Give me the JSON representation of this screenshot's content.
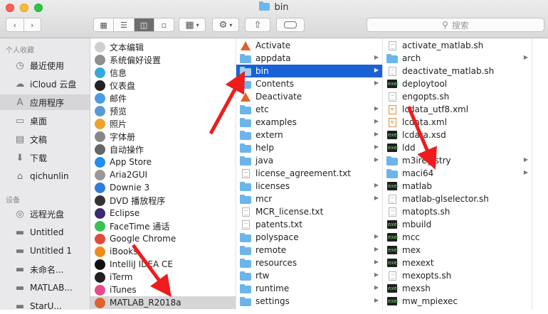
{
  "window": {
    "title": "bin"
  },
  "toolbar": {
    "search_placeholder": "搜索"
  },
  "sidebar": {
    "favorites_header": "个人收藏",
    "favorites": [
      {
        "label": "最近使用",
        "icon": "clock-icon"
      },
      {
        "label": "iCloud 云盘",
        "icon": "cloud-icon"
      },
      {
        "label": "应用程序",
        "icon": "applications-icon",
        "selected": true
      },
      {
        "label": "桌面",
        "icon": "desktop-icon"
      },
      {
        "label": "文稿",
        "icon": "documents-icon"
      },
      {
        "label": "下载",
        "icon": "download-icon"
      },
      {
        "label": "qichunlin",
        "icon": "home-icon"
      }
    ],
    "devices_header": "设备",
    "devices": [
      {
        "label": "远程光盘",
        "icon": "disc-icon"
      },
      {
        "label": "Untitled",
        "icon": "disk-icon"
      },
      {
        "label": "Untitled 1",
        "icon": "disk-icon"
      },
      {
        "label": "未命名...",
        "icon": "disk-icon"
      },
      {
        "label": "MATLAB...",
        "icon": "disk-icon"
      },
      {
        "label": "StarU...",
        "icon": "disk-icon"
      }
    ]
  },
  "columns": {
    "apps": [
      {
        "label": "文本编辑",
        "icon": "textedit-icon",
        "color": "#cfcfcf"
      },
      {
        "label": "系统偏好设置",
        "icon": "gear-icon",
        "color": "#8e8e93"
      },
      {
        "label": "信息",
        "icon": "messages-icon",
        "color": "#34aadc"
      },
      {
        "label": "仪表盘",
        "icon": "dashboard-icon",
        "color": "#222222"
      },
      {
        "label": "邮件",
        "icon": "mail-icon",
        "color": "#4a9be8"
      },
      {
        "label": "预览",
        "icon": "preview-icon",
        "color": "#5b9bd5"
      },
      {
        "label": "照片",
        "icon": "photos-icon",
        "color": "#f0a030"
      },
      {
        "label": "字体册",
        "icon": "fontbook-icon",
        "color": "#888888"
      },
      {
        "label": "自动操作",
        "icon": "automator-icon",
        "color": "#666666"
      },
      {
        "label": "App Store",
        "icon": "appstore-icon",
        "color": "#1f8ff0"
      },
      {
        "label": "Aria2GUI",
        "icon": "aria2gui-icon",
        "color": "#999999"
      },
      {
        "label": "Downie 3",
        "icon": "downie-icon",
        "color": "#2f7de0"
      },
      {
        "label": "DVD 播放程序",
        "icon": "dvd-icon",
        "color": "#333333"
      },
      {
        "label": "Eclipse",
        "icon": "eclipse-icon",
        "color": "#3b2a6e"
      },
      {
        "label": "FaceTime 通话",
        "icon": "facetime-icon",
        "color": "#37c34f"
      },
      {
        "label": "Google Chrome",
        "icon": "chrome-icon",
        "color": "#e04a3a"
      },
      {
        "label": "iBooks",
        "icon": "ibooks-icon",
        "color": "#f08c1e"
      },
      {
        "label": "IntelliJ IDEA CE",
        "icon": "intellij-icon",
        "color": "#111111"
      },
      {
        "label": "iTerm",
        "icon": "iterm-icon",
        "color": "#222222"
      },
      {
        "label": "iTunes",
        "icon": "itunes-icon",
        "color": "#e84a8e"
      },
      {
        "label": "MATLAB_R2018a",
        "icon": "matlab-icon",
        "color": "#e0622c",
        "selected": true
      }
    ],
    "matlab_contents": [
      {
        "label": "Activate",
        "type": "matlab",
        "folder_arrow": false
      },
      {
        "label": "appdata",
        "type": "folder",
        "folder_arrow": true
      },
      {
        "label": "bin",
        "type": "folder",
        "folder_arrow": true,
        "selected": true
      },
      {
        "label": "Contents",
        "type": "folder",
        "folder_arrow": true
      },
      {
        "label": "Deactivate",
        "type": "matlab",
        "folder_arrow": false
      },
      {
        "label": "etc",
        "type": "folder",
        "folder_arrow": true
      },
      {
        "label": "examples",
        "type": "folder",
        "folder_arrow": true
      },
      {
        "label": "extern",
        "type": "folder",
        "folder_arrow": true
      },
      {
        "label": "help",
        "type": "folder",
        "folder_arrow": true
      },
      {
        "label": "java",
        "type": "folder",
        "folder_arrow": true
      },
      {
        "label": "license_agreement.txt",
        "type": "doc",
        "folder_arrow": false
      },
      {
        "label": "licenses",
        "type": "folder",
        "folder_arrow": true
      },
      {
        "label": "mcr",
        "type": "folder",
        "folder_arrow": true
      },
      {
        "label": "MCR_license.txt",
        "type": "doc",
        "folder_arrow": false
      },
      {
        "label": "patents.txt",
        "type": "doc",
        "folder_arrow": false
      },
      {
        "label": "polyspace",
        "type": "folder",
        "folder_arrow": true
      },
      {
        "label": "remote",
        "type": "folder",
        "folder_arrow": true
      },
      {
        "label": "resources",
        "type": "folder",
        "folder_arrow": true
      },
      {
        "label": "rtw",
        "type": "folder",
        "folder_arrow": true
      },
      {
        "label": "runtime",
        "type": "folder",
        "folder_arrow": true
      },
      {
        "label": "settings",
        "type": "folder",
        "folder_arrow": true
      }
    ],
    "bin_contents": [
      {
        "label": "activate_matlab.sh",
        "type": "doc",
        "folder_arrow": false
      },
      {
        "label": "arch",
        "type": "folder",
        "folder_arrow": true
      },
      {
        "label": "deactivate_matlab.sh",
        "type": "doc",
        "folder_arrow": false
      },
      {
        "label": "deploytool",
        "type": "term",
        "folder_arrow": false
      },
      {
        "label": "engopts.sh",
        "type": "doc",
        "folder_arrow": false
      },
      {
        "label": "lcdata_utf8.xml",
        "type": "xml",
        "folder_arrow": false
      },
      {
        "label": "lcdata.xml",
        "type": "xml",
        "folder_arrow": false
      },
      {
        "label": "lcdata.xsd",
        "type": "term",
        "folder_arrow": false
      },
      {
        "label": "ldd",
        "type": "term",
        "folder_arrow": false
      },
      {
        "label": "m3iregistry",
        "type": "folder",
        "folder_arrow": true
      },
      {
        "label": "maci64",
        "type": "folder",
        "folder_arrow": true
      },
      {
        "label": "matlab",
        "type": "term",
        "folder_arrow": false
      },
      {
        "label": "matlab-glselector.sh",
        "type": "doc",
        "folder_arrow": false
      },
      {
        "label": "matopts.sh",
        "type": "doc",
        "folder_arrow": false
      },
      {
        "label": "mbuild",
        "type": "term",
        "folder_arrow": false
      },
      {
        "label": "mcc",
        "type": "term",
        "folder_arrow": false
      },
      {
        "label": "mex",
        "type": "term",
        "folder_arrow": false
      },
      {
        "label": "mexext",
        "type": "term",
        "folder_arrow": false
      },
      {
        "label": "mexopts.sh",
        "type": "doc",
        "folder_arrow": false
      },
      {
        "label": "mexsh",
        "type": "term",
        "folder_arrow": false
      },
      {
        "label": "mw_mpiexec",
        "type": "term",
        "folder_arrow": false
      }
    ]
  },
  "colors": {
    "selection": "#1a61d6",
    "annotation": "#ee1c1c",
    "folder": "#6cb5ea"
  }
}
